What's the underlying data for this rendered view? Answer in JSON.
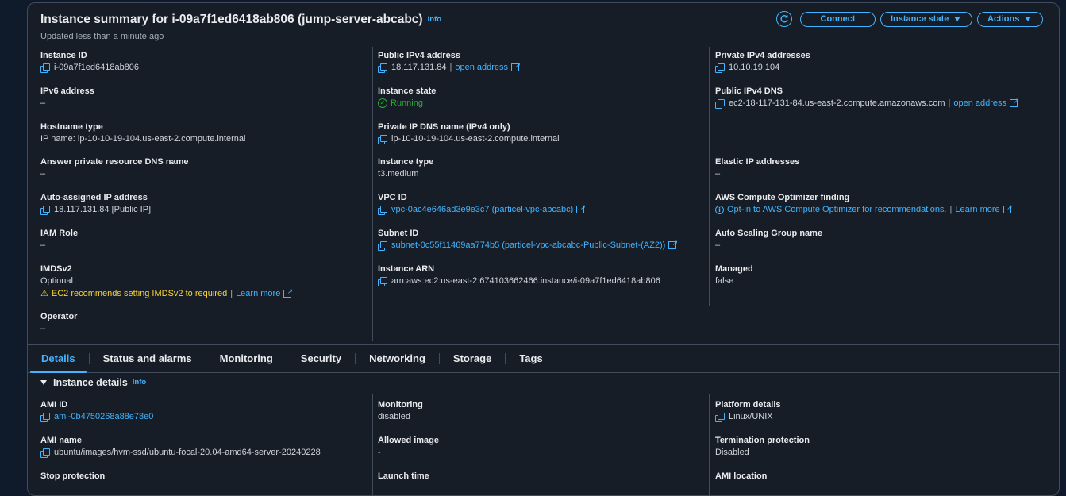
{
  "summary": {
    "title": "Instance summary for i-09a7f1ed6418ab806 (jump-server-abcabc)",
    "info": "Info",
    "updated": "Updated less than a minute ago",
    "buttons": {
      "connect": "Connect",
      "instance_state": "Instance state",
      "actions": "Actions"
    }
  },
  "col1": {
    "instance_id_label": "Instance ID",
    "instance_id": "i-09a7f1ed6418ab806",
    "ipv6_label": "IPv6 address",
    "ipv6": "–",
    "hostname_type_label": "Hostname type",
    "hostname_type": "IP name: ip-10-10-19-104.us-east-2.compute.internal",
    "answer_dns_label": "Answer private resource DNS name",
    "answer_dns": "–",
    "auto_ip_label": "Auto-assigned IP address",
    "auto_ip": "18.117.131.84 [Public IP]",
    "iam_label": "IAM Role",
    "iam": "–",
    "imds_label": "IMDSv2",
    "imds": "Optional",
    "imds_warning": "EC2 recommends setting IMDSv2 to required",
    "learn_more": "Learn more",
    "operator_label": "Operator",
    "operator": "–"
  },
  "col2": {
    "public_ipv4_label": "Public IPv4 address",
    "public_ipv4": "18.117.131.84",
    "open_address": "open address",
    "state_label": "Instance state",
    "state": "Running",
    "private_dns_label": "Private IP DNS name (IPv4 only)",
    "private_dns": "ip-10-10-19-104.us-east-2.compute.internal",
    "type_label": "Instance type",
    "type": "t3.medium",
    "vpc_label": "VPC ID",
    "vpc": "vpc-0ac4e646ad3e9e3c7 (particel-vpc-abcabc)",
    "subnet_label": "Subnet ID",
    "subnet": "subnet-0c55f11469aa774b5 (particel-vpc-abcabc-Public-Subnet-(AZ2))",
    "arn_label": "Instance ARN",
    "arn": "arn:aws:ec2:us-east-2:674103662466:instance/i-09a7f1ed6418ab806"
  },
  "col3": {
    "private_ipv4_label": "Private IPv4 addresses",
    "private_ipv4": "10.10.19.104",
    "public_dns_label": "Public IPv4 DNS",
    "public_dns": "ec2-18-117-131-84.us-east-2.compute.amazonaws.com",
    "open_address": "open address",
    "elastic_label": "Elastic IP addresses",
    "elastic": "–",
    "optimizer_label": "AWS Compute Optimizer finding",
    "optimizer": "Opt-in to AWS Compute Optimizer for recommendations.",
    "learn_more": "Learn more",
    "asg_label": "Auto Scaling Group name",
    "asg": "–",
    "managed_label": "Managed",
    "managed": "false"
  },
  "tabs": [
    "Details",
    "Status and alarms",
    "Monitoring",
    "Security",
    "Networking",
    "Storage",
    "Tags"
  ],
  "details": {
    "heading": "Instance details",
    "info": "Info",
    "ami_id_label": "AMI ID",
    "ami_id": "ami-0b4750268a88e78e0",
    "ami_name_label": "AMI name",
    "ami_name": "ubuntu/images/hvm-ssd/ubuntu-focal-20.04-amd64-server-20240228",
    "stop_protection_label": "Stop protection",
    "monitoring_label": "Monitoring",
    "monitoring": "disabled",
    "allowed_image_label": "Allowed image",
    "allowed_image": "-",
    "launch_time_label": "Launch time",
    "platform_label": "Platform details",
    "platform": "Linux/UNIX",
    "termination_label": "Termination protection",
    "termination": "Disabled",
    "ami_location_label": "AMI location"
  },
  "colors": {
    "accent": "#42b4ff",
    "success": "#29ad32",
    "warning": "#fbd332",
    "background": "#161d26"
  }
}
